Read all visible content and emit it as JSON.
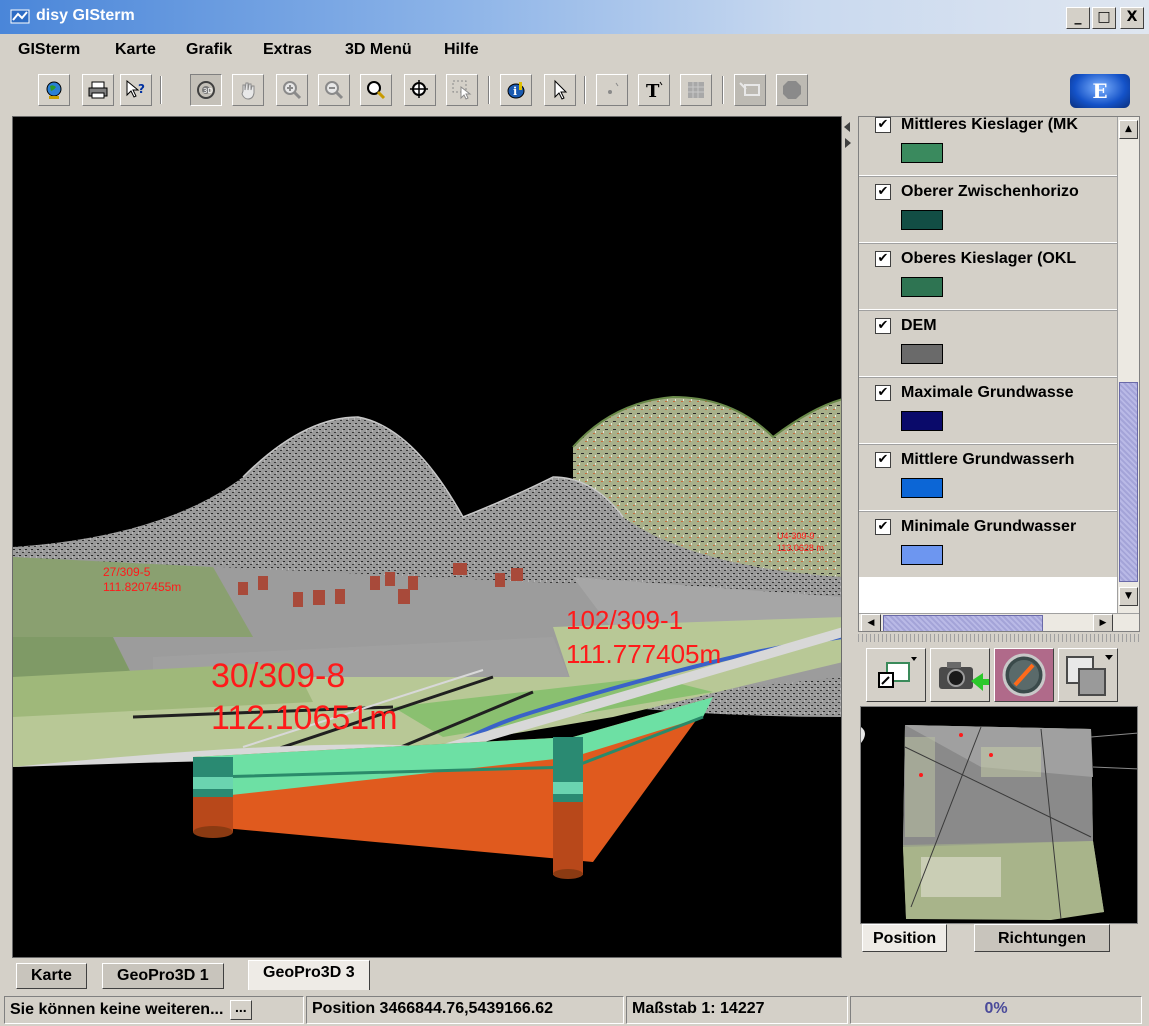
{
  "window": {
    "title": "disy GISterm",
    "minimize": "_",
    "maximize": "□",
    "close": "X"
  },
  "menu": [
    "GISterm",
    "Karte",
    "Grafik",
    "Extras",
    "3D Menü",
    "Hilfe"
  ],
  "toolbar": {
    "buttons": [
      "globe-icon",
      "print-icon",
      "help-pointer-icon",
      "3d-view-icon",
      "pan-hand-icon",
      "zoom-in-icon",
      "zoom-out-icon",
      "zoom-magnifier-icon",
      "zoom-extent-icon",
      "select-rect-icon",
      "info-icon",
      "select-arrow-icon",
      "point-icon",
      "text-icon",
      "raster-icon",
      "measure-icon",
      "polygon-icon"
    ],
    "logo": "E"
  },
  "viewport": {
    "annotations": [
      {
        "line1": "30/309-8",
        "line2": "112.10651m"
      },
      {
        "line1": "102/309-1",
        "line2": "111.777405m"
      },
      {
        "line1": "27/309-5",
        "line2": "111.8207455m"
      },
      {
        "line1": "U4-309-9",
        "line2": "113.0628 m"
      }
    ]
  },
  "layers": [
    {
      "label": "Mittleres Kieslager (MK",
      "color": "#3a8a5e",
      "checked": "✔"
    },
    {
      "label": "Oberer Zwischenhorizo",
      "color": "#124d44",
      "checked": "✔"
    },
    {
      "label": "Oberes Kieslager (OKL",
      "color": "#2e7452",
      "checked": "✔"
    },
    {
      "label": "DEM",
      "color": "#6a6a6a",
      "checked": "✔"
    },
    {
      "label": "Maximale Grundwasse",
      "color": "#0a0a6a",
      "checked": "✔"
    },
    {
      "label": "Mittlere Grundwasserh",
      "color": "#0c66d6",
      "checked": "✔"
    },
    {
      "label": "Minimale Grundwasser",
      "color": "#6d96f0",
      "checked": "✔"
    }
  ],
  "overview_tools": [
    "frame-icon",
    "camera-icon",
    "compass-icon",
    "layers-select-icon"
  ],
  "overview_tabs": [
    "Position",
    "Richtungen"
  ],
  "doc_tabs": [
    "Karte",
    "GeoPro3D 1",
    "GeoPro3D 3"
  ],
  "status": {
    "message": "Sie können keine weiteren...",
    "more": "...",
    "position": "Position 3466844.76,5439166.62",
    "scale": "Maßstab 1: 14227",
    "progress": "0%"
  }
}
